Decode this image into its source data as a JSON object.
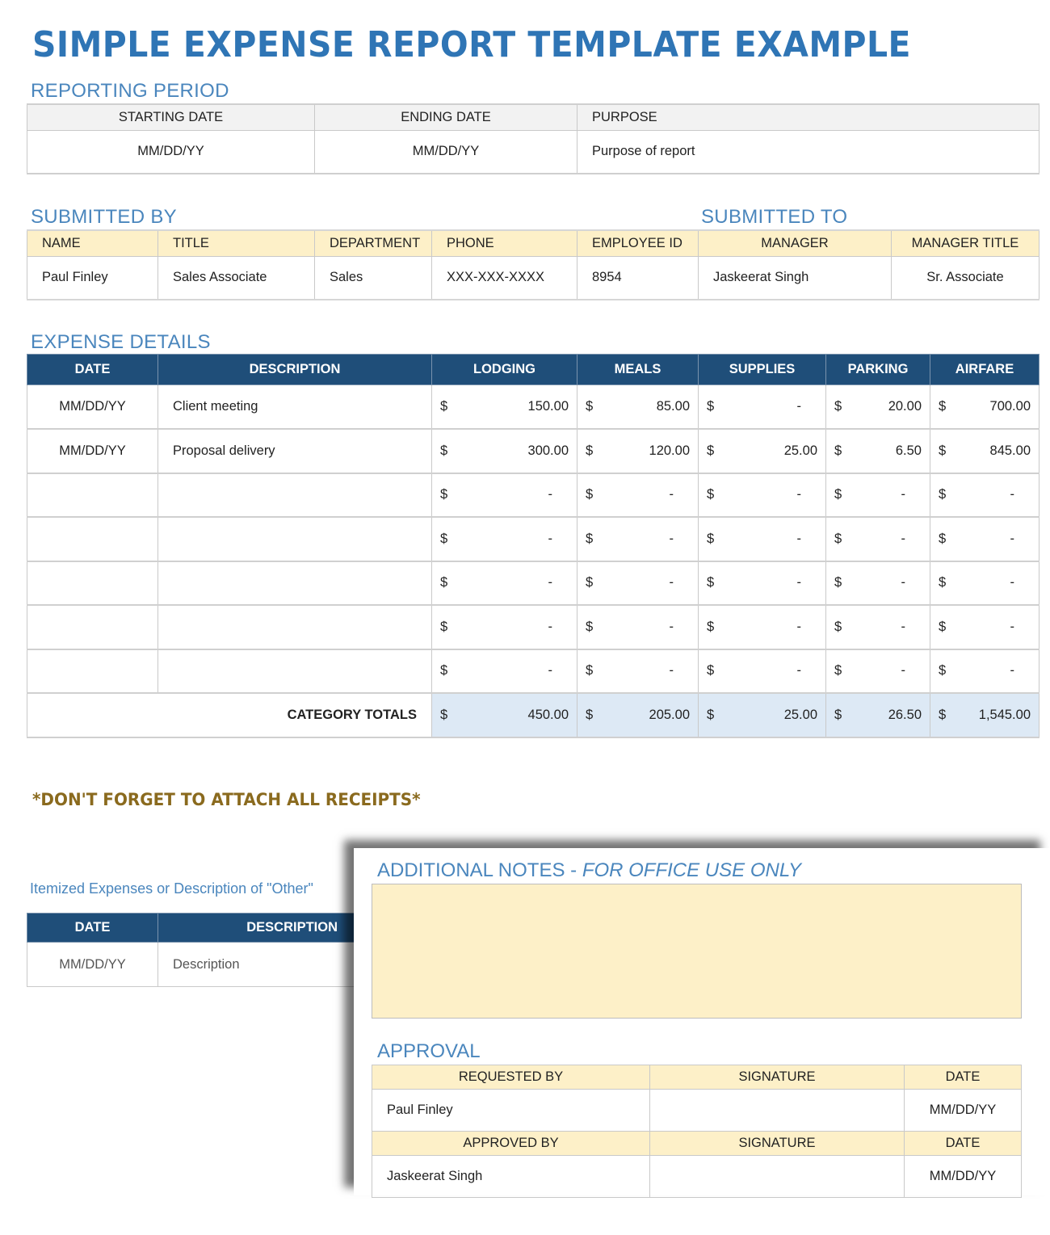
{
  "title": "SIMPLE EXPENSE REPORT TEMPLATE EXAMPLE",
  "reporting_period": {
    "label": "REPORTING PERIOD",
    "headers": [
      "STARTING DATE",
      "ENDING DATE",
      "PURPOSE"
    ],
    "values": [
      "MM/DD/YY",
      "MM/DD/YY",
      "Purpose of report"
    ]
  },
  "submitted": {
    "by_label": "SUBMITTED BY",
    "to_label": "SUBMITTED TO",
    "headers": [
      "NAME",
      "TITLE",
      "DEPARTMENT",
      "PHONE",
      "EMPLOYEE ID",
      "MANAGER",
      "MANAGER TITLE"
    ],
    "values": [
      "Paul Finley",
      "Sales Associate",
      "Sales",
      "XXX-XXX-XXXX",
      "8954",
      "Jaskeerat Singh",
      "Sr. Associate"
    ]
  },
  "expense_details": {
    "label": "EXPENSE DETAILS",
    "headers": [
      "DATE",
      "DESCRIPTION",
      "LODGING",
      "MEALS",
      "SUPPLIES",
      "PARKING",
      "AIRFARE"
    ],
    "currency": "$",
    "rows": [
      {
        "date": "MM/DD/YY",
        "description": "Client meeting",
        "amounts": [
          "150.00",
          "85.00",
          "-",
          "20.00",
          "700.00"
        ]
      },
      {
        "date": "MM/DD/YY",
        "description": "Proposal delivery",
        "amounts": [
          "300.00",
          "120.00",
          "25.00",
          "6.50",
          "845.00"
        ]
      },
      {
        "date": "",
        "description": "",
        "amounts": [
          "-",
          "-",
          "-",
          "-",
          "-"
        ]
      },
      {
        "date": "",
        "description": "",
        "amounts": [
          "-",
          "-",
          "-",
          "-",
          "-"
        ]
      },
      {
        "date": "",
        "description": "",
        "amounts": [
          "-",
          "-",
          "-",
          "-",
          "-"
        ]
      },
      {
        "date": "",
        "description": "",
        "amounts": [
          "-",
          "-",
          "-",
          "-",
          "-"
        ]
      },
      {
        "date": "",
        "description": "",
        "amounts": [
          "-",
          "-",
          "-",
          "-",
          "-"
        ]
      }
    ],
    "totals_label": "CATEGORY TOTALS",
    "totals": [
      "450.00",
      "205.00",
      "25.00",
      "26.50",
      "1,545.00"
    ]
  },
  "receipts_reminder": "*DON'T FORGET TO ATTACH ALL RECEIPTS*",
  "itemized": {
    "label": "Itemized Expenses or Description of \"Other\"",
    "headers": [
      "DATE",
      "DESCRIPTION"
    ],
    "row": [
      "MM/DD/YY",
      "Description"
    ]
  },
  "notes": {
    "label_main": "ADDITIONAL NOTES - ",
    "label_italic": "FOR OFFICE USE ONLY",
    "value": ""
  },
  "approval": {
    "label": "APPROVAL",
    "requested_headers": [
      "REQUESTED BY",
      "SIGNATURE",
      "DATE"
    ],
    "requested_values": [
      "Paul Finley",
      "",
      "MM/DD/YY"
    ],
    "approved_headers": [
      "APPROVED BY",
      "SIGNATURE",
      "DATE"
    ],
    "approved_values": [
      "Jaskeerat Singh",
      "",
      "MM/DD/YY"
    ]
  },
  "colors": {
    "title_blue": "#2f75b5",
    "section_blue": "#4a86bd",
    "header_navy": "#1f4e79",
    "header_cream": "#fdf0c8",
    "totals_blue": "#dde9f5",
    "reminder_gold": "#8a6a1e"
  }
}
